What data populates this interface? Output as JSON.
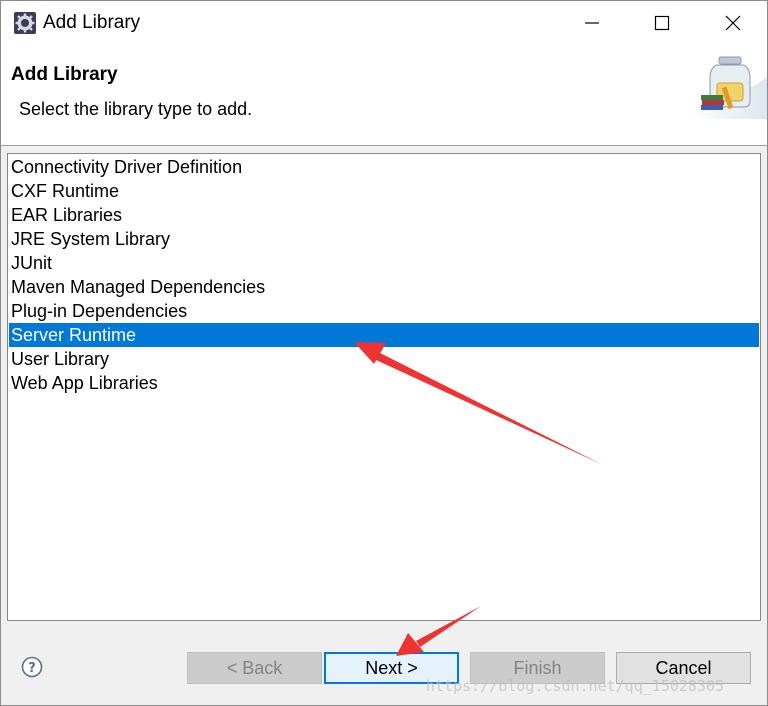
{
  "window": {
    "title": "Add Library"
  },
  "header": {
    "title": "Add Library",
    "description": "Select the library type to add."
  },
  "library_list": {
    "items": [
      {
        "label": "Connectivity Driver Definition",
        "selected": false
      },
      {
        "label": "CXF Runtime",
        "selected": false
      },
      {
        "label": "EAR Libraries",
        "selected": false
      },
      {
        "label": "JRE System Library",
        "selected": false
      },
      {
        "label": "JUnit",
        "selected": false
      },
      {
        "label": "Maven Managed Dependencies",
        "selected": false
      },
      {
        "label": "Plug-in Dependencies",
        "selected": false
      },
      {
        "label": "Server Runtime",
        "selected": true
      },
      {
        "label": "User Library",
        "selected": false
      },
      {
        "label": "Web App Libraries",
        "selected": false
      }
    ]
  },
  "buttons": {
    "back": "< Back",
    "next": "Next >",
    "finish": "Finish",
    "cancel": "Cancel"
  },
  "watermark": "https://blog.csdn.net/qq_15028305",
  "icons": {
    "app": "eclipse-gear-icon",
    "header": "library-jar-books-icon",
    "help": "help-question-icon",
    "minimize": "minimize-icon",
    "maximize": "maximize-icon",
    "close": "close-icon"
  },
  "colors": {
    "selection": "#0078d7",
    "annotation_arrow": "#ee3333"
  }
}
